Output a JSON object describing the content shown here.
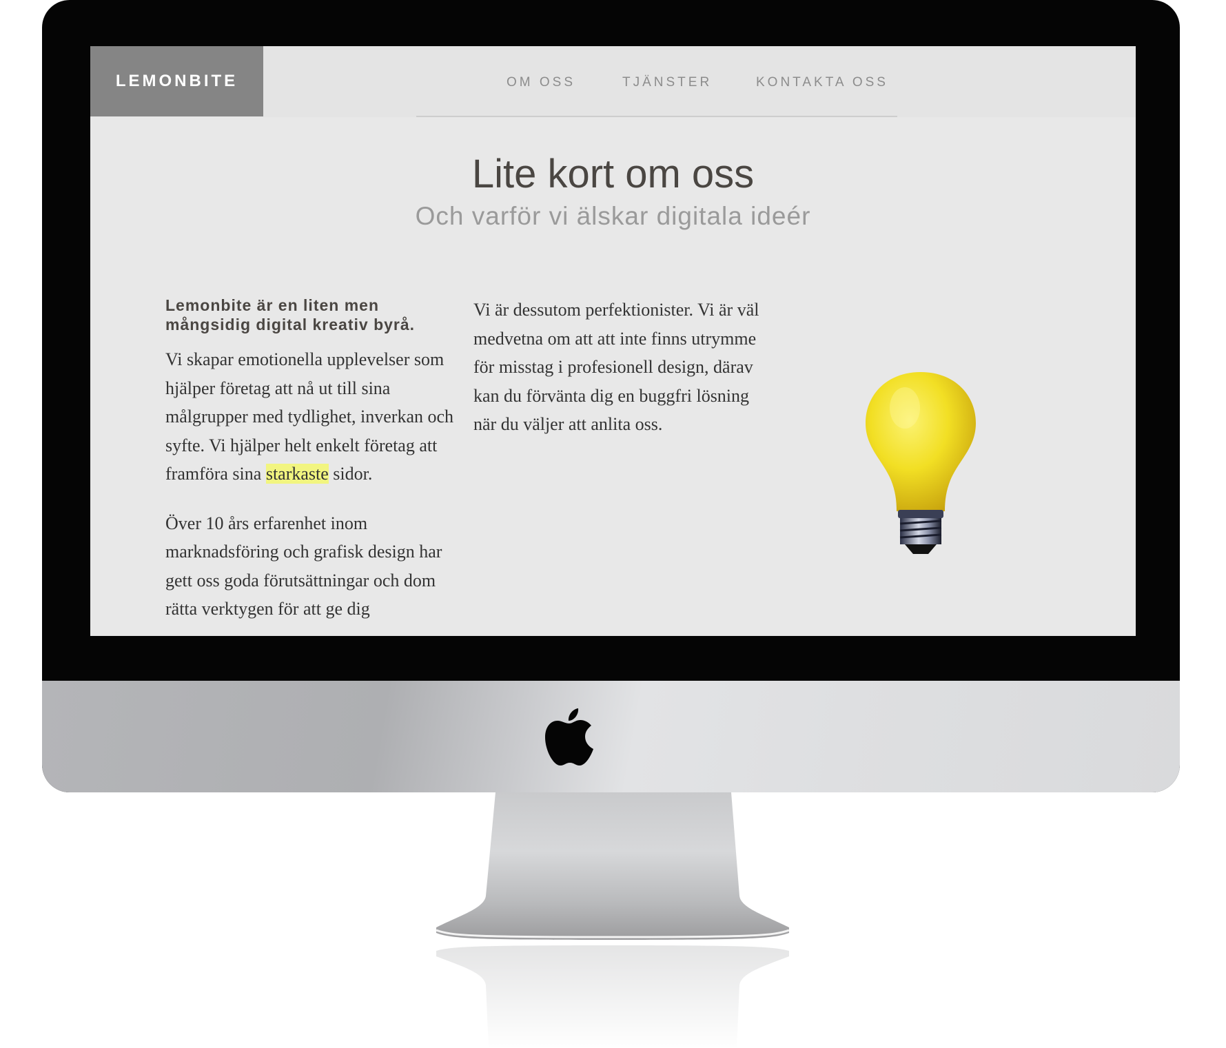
{
  "site": {
    "logo": "LEMONBITE",
    "nav": [
      "OM OSS",
      "TJÄNSTER",
      "KONTAKTA OSS"
    ]
  },
  "hero": {
    "title": "Lite kort om oss",
    "subtitle": "Och varför vi älskar digitala ideér"
  },
  "content": {
    "lead": "Lemonbite är en liten men mångsidig digital kreativ byrå.",
    "para1_before": "Vi skapar emotionella upplevelser som hjälper företag att nå ut till sina målgrupper med tydlighet, inverkan och syfte. Vi hjälper helt enkelt företag att framföra sina ",
    "para1_highlight": "starkaste",
    "para1_after": " sidor.",
    "para2": "Över 10 års erfarenhet inom marknadsföring och grafisk design har gett oss goda förutsättningar och dom rätta verktygen för att ge dig",
    "para3": "Vi är dessutom perfektionister. Vi är väl medvetna om att att inte finns utrymme för misstag i profesionell design, därav kan du förvänta dig en buggfri lösning när du väljer att anlita oss."
  },
  "images": {
    "bulb": "lemon-lightbulb-image",
    "device_logo": "apple-icon"
  },
  "colors": {
    "screen_bg": "#e8e8e8",
    "logo_bg": "#858585",
    "highlight": "#f2f580",
    "bezel": "#050505"
  }
}
